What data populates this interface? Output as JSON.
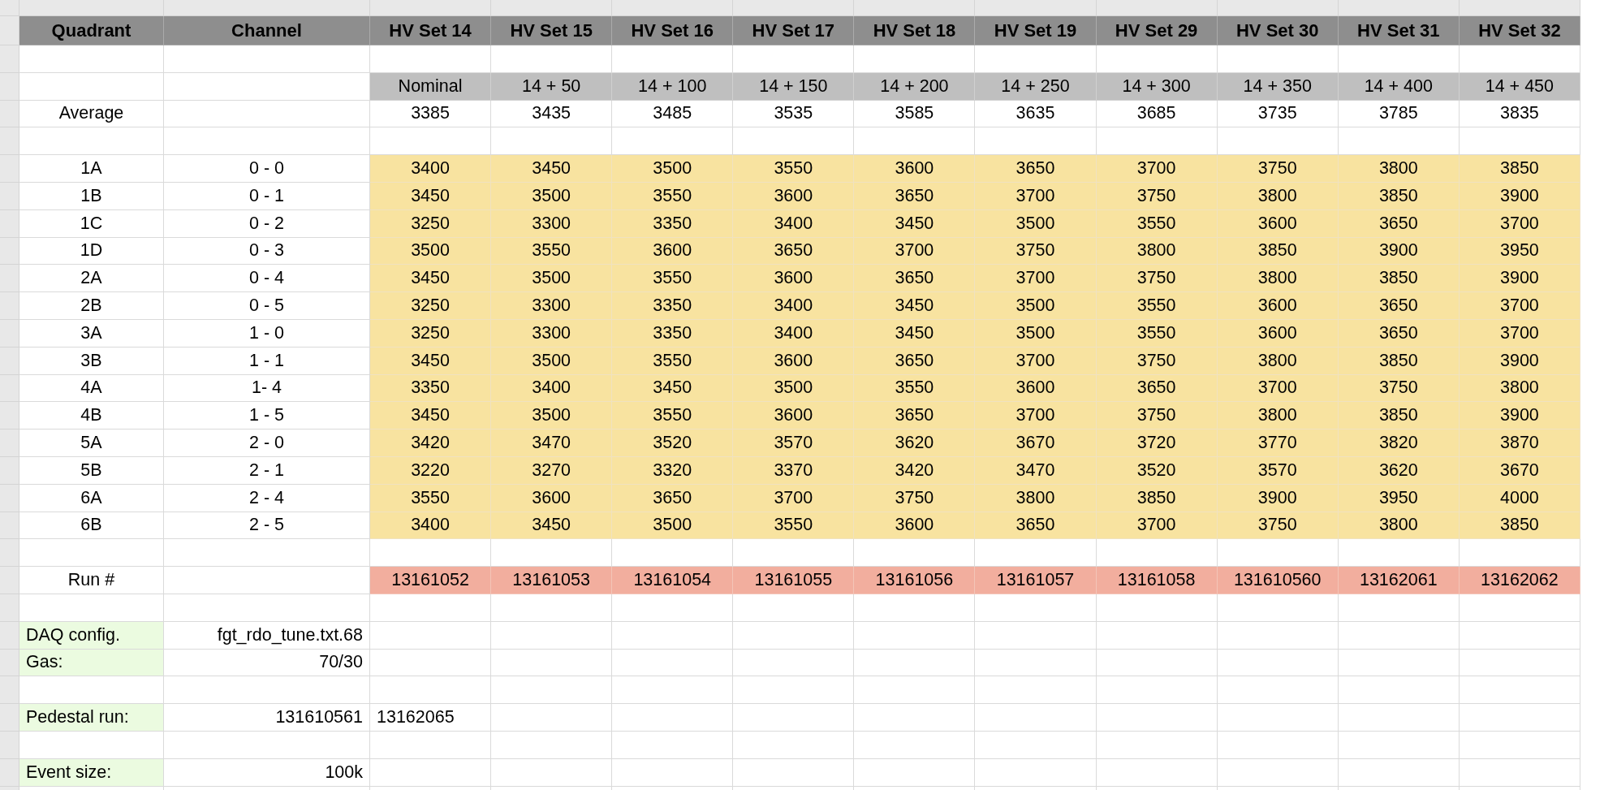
{
  "columns": [
    "Quadrant",
    "Channel",
    "HV Set 14",
    "HV Set 15",
    "HV Set 16",
    "HV Set 17",
    "HV Set 18",
    "HV Set 19",
    "HV Set 29",
    "HV Set 30",
    "HV Set 31",
    "HV Set 32"
  ],
  "offsets": [
    "Nominal",
    "14 + 50",
    "14 + 100",
    "14 + 150",
    "14 + 200",
    "14 + 250",
    "14 + 300",
    "14 + 350",
    "14 + 400",
    "14 + 450"
  ],
  "average": {
    "label": "Average",
    "values": [
      "3385",
      "3435",
      "3485",
      "3535",
      "3585",
      "3635",
      "3685",
      "3735",
      "3785",
      "3835"
    ]
  },
  "channels": [
    {
      "quadrant": "1A",
      "channel": "0 - 0",
      "values": [
        "3400",
        "3450",
        "3500",
        "3550",
        "3600",
        "3650",
        "3700",
        "3750",
        "3800",
        "3850"
      ]
    },
    {
      "quadrant": "1B",
      "channel": "0 - 1",
      "values": [
        "3450",
        "3500",
        "3550",
        "3600",
        "3650",
        "3700",
        "3750",
        "3800",
        "3850",
        "3900"
      ]
    },
    {
      "quadrant": "1C",
      "channel": "0 - 2",
      "values": [
        "3250",
        "3300",
        "3350",
        "3400",
        "3450",
        "3500",
        "3550",
        "3600",
        "3650",
        "3700"
      ]
    },
    {
      "quadrant": "1D",
      "channel": "0 - 3",
      "values": [
        "3500",
        "3550",
        "3600",
        "3650",
        "3700",
        "3750",
        "3800",
        "3850",
        "3900",
        "3950"
      ]
    },
    {
      "quadrant": "2A",
      "channel": "0 - 4",
      "values": [
        "3450",
        "3500",
        "3550",
        "3600",
        "3650",
        "3700",
        "3750",
        "3800",
        "3850",
        "3900"
      ]
    },
    {
      "quadrant": "2B",
      "channel": "0 - 5",
      "values": [
        "3250",
        "3300",
        "3350",
        "3400",
        "3450",
        "3500",
        "3550",
        "3600",
        "3650",
        "3700"
      ]
    },
    {
      "quadrant": "3A",
      "channel": "1 - 0",
      "values": [
        "3250",
        "3300",
        "3350",
        "3400",
        "3450",
        "3500",
        "3550",
        "3600",
        "3650",
        "3700"
      ]
    },
    {
      "quadrant": "3B",
      "channel": "1 - 1",
      "values": [
        "3450",
        "3500",
        "3550",
        "3600",
        "3650",
        "3700",
        "3750",
        "3800",
        "3850",
        "3900"
      ]
    },
    {
      "quadrant": "4A",
      "channel": "1- 4",
      "values": [
        "3350",
        "3400",
        "3450",
        "3500",
        "3550",
        "3600",
        "3650",
        "3700",
        "3750",
        "3800"
      ]
    },
    {
      "quadrant": "4B",
      "channel": "1 - 5",
      "values": [
        "3450",
        "3500",
        "3550",
        "3600",
        "3650",
        "3700",
        "3750",
        "3800",
        "3850",
        "3900"
      ]
    },
    {
      "quadrant": "5A",
      "channel": "2 - 0",
      "values": [
        "3420",
        "3470",
        "3520",
        "3570",
        "3620",
        "3670",
        "3720",
        "3770",
        "3820",
        "3870"
      ]
    },
    {
      "quadrant": "5B",
      "channel": "2 - 1",
      "values": [
        "3220",
        "3270",
        "3320",
        "3370",
        "3420",
        "3470",
        "3520",
        "3570",
        "3620",
        "3670"
      ]
    },
    {
      "quadrant": "6A",
      "channel": "2 - 4",
      "values": [
        "3550",
        "3600",
        "3650",
        "3700",
        "3750",
        "3800",
        "3850",
        "3900",
        "3950",
        "4000"
      ]
    },
    {
      "quadrant": "6B",
      "channel": "2 - 5",
      "values": [
        "3400",
        "3450",
        "3500",
        "3550",
        "3600",
        "3650",
        "3700",
        "3750",
        "3800",
        "3850"
      ]
    }
  ],
  "runs": {
    "label": "Run #",
    "values": [
      "13161052",
      "13161053",
      "13161054",
      "13161055",
      "13161056",
      "13161057",
      "13161058",
      "131610560",
      "13162061",
      "13162062"
    ]
  },
  "settings": [
    {
      "label": "DAQ config.",
      "value": "fgt_rdo_tune.txt.68"
    },
    {
      "label": "Gas:",
      "value": "70/30"
    },
    {
      "label": "Pedestal run:",
      "value": "131610561",
      "extra": "13162065"
    },
    {
      "label": "Event size:",
      "value": "100k"
    }
  ]
}
